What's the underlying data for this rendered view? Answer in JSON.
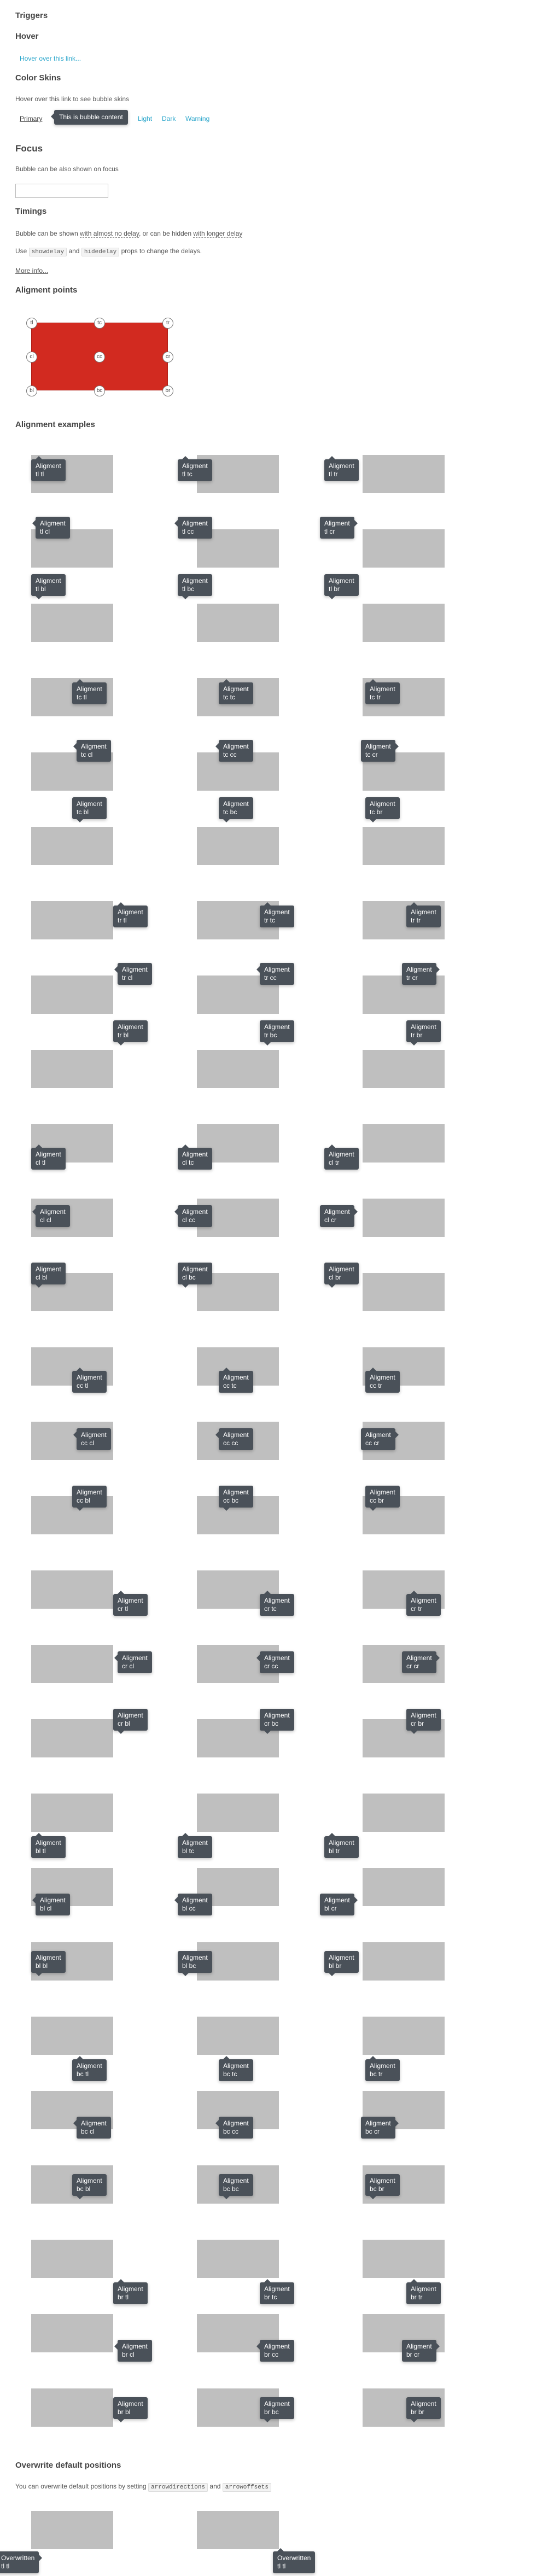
{
  "triggers": {
    "title": "Triggers"
  },
  "hover": {
    "title": "Hover",
    "link_text": "Hover over this link..."
  },
  "skins": {
    "title": "Color Skins",
    "desc": "Hover over this link to see bubble skins",
    "tabs": [
      "Primary",
      "Light",
      "Dark",
      "Warning"
    ],
    "tooltip": "This is bubble content"
  },
  "focus": {
    "title": "Focus",
    "desc": "Bubble can be also shown on focus"
  },
  "timings": {
    "title": "Timings",
    "desc_a": "Bubble can be shown ",
    "desc_link1": "with almost no delay",
    "desc_b": ", or can be hidden ",
    "desc_link2": "with longer delay",
    "use": "Use",
    "code1": "showdelay",
    "and": "and",
    "code2": "hidedelay",
    "use_tail": "props to change the delays.",
    "more": "More info..."
  },
  "points": {
    "title": "Aligment points",
    "labels": [
      "tl",
      "tc",
      "tr",
      "cl",
      "cc",
      "cr",
      "bl",
      "bc",
      "br"
    ]
  },
  "examples": {
    "title": "Alignment examples",
    "tip_line1": "Aligment",
    "grid": [
      [
        "tl tl",
        "tl tc",
        "tl tr"
      ],
      [
        "tl cl",
        "tl cc",
        "tl cr"
      ],
      [
        "tl bl",
        "tl bc",
        "tl br"
      ],
      [
        "tc tl",
        "tc tc",
        "tc tr"
      ],
      [
        "tc cl",
        "tc cc",
        "tc cr"
      ],
      [
        "tc bl",
        "tc bc",
        "tc br"
      ],
      [
        "tr tl",
        "tr tc",
        "tr tr"
      ],
      [
        "tr cl",
        "tr cc",
        "tr cr"
      ],
      [
        "tr bl",
        "tr bc",
        "tr br"
      ],
      [
        "cl tl",
        "cl tc",
        "cl tr"
      ],
      [
        "cl cl",
        "cl cc",
        "cl cr"
      ],
      [
        "cl bl",
        "cl bc",
        "cl br"
      ],
      [
        "cc tl",
        "cc tc",
        "cc tr"
      ],
      [
        "cc cl",
        "cc cc",
        "cc cr"
      ],
      [
        "cc bl",
        "cc bc",
        "cc br"
      ],
      [
        "cr tl",
        "cr tc",
        "cr tr"
      ],
      [
        "cr cl",
        "cr cc",
        "cr cr"
      ],
      [
        "cr bl",
        "cr bc",
        "cr br"
      ],
      [
        "bl tl",
        "bl tc",
        "bl tr"
      ],
      [
        "bl cl",
        "bl cc",
        "bl cr"
      ],
      [
        "bl bl",
        "bl bc",
        "bl br"
      ],
      [
        "bc tl",
        "bc tc",
        "bc tr"
      ],
      [
        "bc cl",
        "bc cc",
        "bc cr"
      ],
      [
        "bc bl",
        "bc bc",
        "bc br"
      ],
      [
        "br tl",
        "br tc",
        "br tr"
      ],
      [
        "br cl",
        "br cc",
        "br cr"
      ],
      [
        "br bl",
        "br bc",
        "br br"
      ]
    ]
  },
  "override": {
    "title": "Overwrite default positions",
    "desc_a": "You can overwrite default positions by setting",
    "code1": "arrowdirections",
    "and": "and",
    "code2": "arrowoffsets",
    "tip1_line1": "Overwritten",
    "tip1_line2": "tl tl",
    "tip2_line1": "Overwritten",
    "tip2_line2": "tl tl"
  }
}
